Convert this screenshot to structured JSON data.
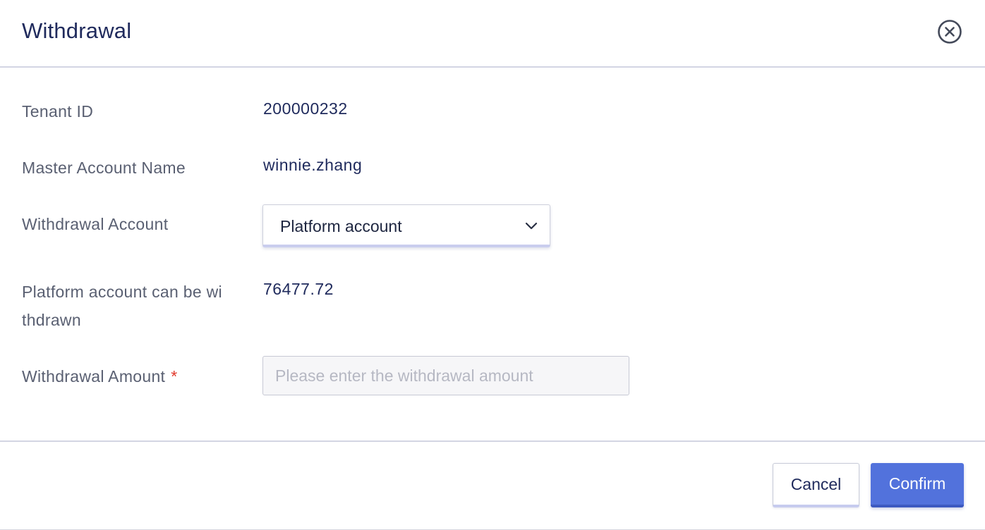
{
  "dialog": {
    "title": "Withdrawal",
    "close_icon": "close-circle-icon"
  },
  "form": {
    "tenant_id": {
      "label": "Tenant ID",
      "value": "200000232"
    },
    "master_account_name": {
      "label": "Master Account Name",
      "value": "winnie.zhang"
    },
    "withdrawal_account": {
      "label": "Withdrawal Account",
      "selected": "Platform account",
      "icon": "chevron-down-icon"
    },
    "withdrawable": {
      "label_line1": "Platform account can be wi",
      "label_line2": "thdrawn",
      "value": "76477.72"
    },
    "withdrawal_amount": {
      "label": "Withdrawal Amount",
      "required_mark": "*",
      "value": "",
      "placeholder": "Please enter the withdrawal amount"
    }
  },
  "footer": {
    "cancel_label": "Cancel",
    "confirm_label": "Confirm"
  },
  "colors": {
    "title": "#1f2a5c",
    "label": "#5a6072",
    "primary": "#5272dc",
    "required": "#e0392b"
  }
}
